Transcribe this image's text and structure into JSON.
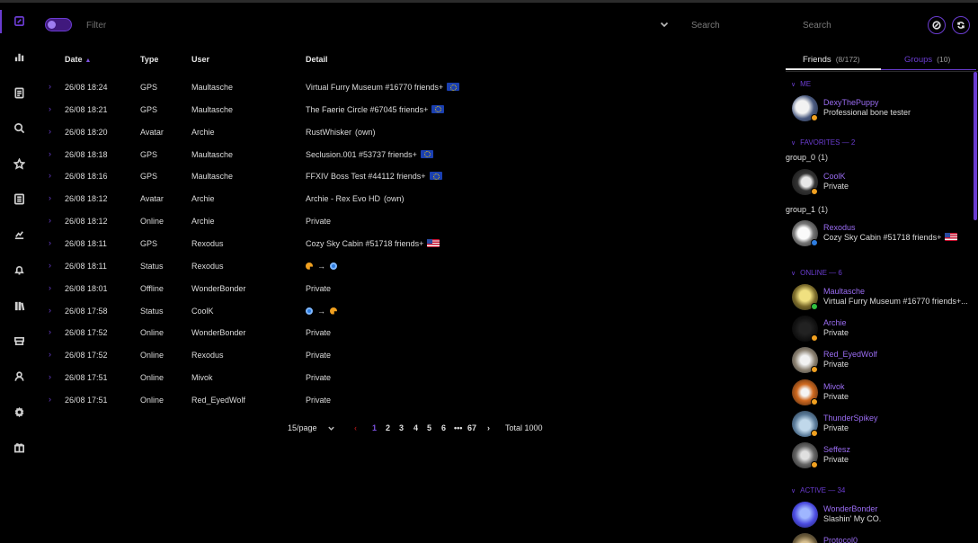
{
  "toolbar": {
    "filter_placeholder": "Filter",
    "search1_placeholder": "Search",
    "search2_placeholder": "Search"
  },
  "sidebar_icons": [
    "feed-icon",
    "chart-icon",
    "document-icon",
    "search-icon",
    "star-icon",
    "list-icon",
    "moderation-icon",
    "bell-icon",
    "book-icon",
    "shop-icon",
    "user-icon",
    "gear-icon",
    "gift-icon"
  ],
  "feed": {
    "columns": {
      "date": "Date",
      "type": "Type",
      "user": "User",
      "detail": "Detail"
    },
    "rows": [
      {
        "date": "26/08 18:24",
        "type": "GPS",
        "user": "Maultasche",
        "detail": "Virtual Furry Museum #16770 friends+",
        "flag": "eu"
      },
      {
        "date": "26/08 18:21",
        "type": "GPS",
        "user": "Maultasche",
        "detail": "The Faerie Circle #67045 friends+",
        "flag": "eu"
      },
      {
        "date": "26/08 18:20",
        "type": "Avatar",
        "user": "Archie",
        "detail": "RustWhisker",
        "own": "(own)"
      },
      {
        "date": "26/08 18:18",
        "type": "GPS",
        "user": "Maultasche",
        "detail": "Seclusion.001 #53737 friends+",
        "flag": "eu"
      },
      {
        "date": "26/08 18:16",
        "type": "GPS",
        "user": "Maultasche",
        "detail": "FFXIV Boss Test #44112 friends+",
        "flag": "eu"
      },
      {
        "date": "26/08 18:12",
        "type": "Avatar",
        "user": "Archie",
        "detail": "Archie - Rex Evo HD",
        "own": "(own)"
      },
      {
        "date": "26/08 18:12",
        "type": "Online",
        "user": "Archie",
        "detail": "Private"
      },
      {
        "date": "26/08 18:11",
        "type": "GPS",
        "user": "Rexodus",
        "detail": "Cozy Sky Cabin #51718 friends+",
        "flag": "us"
      },
      {
        "date": "26/08 18:11",
        "type": "Status",
        "user": "Rexodus",
        "detail": "",
        "status_change": [
          "orange",
          "blue"
        ]
      },
      {
        "date": "26/08 18:01",
        "type": "Offline",
        "user": "WonderBonder",
        "detail": "Private"
      },
      {
        "date": "26/08 17:58",
        "type": "Status",
        "user": "CoolK",
        "detail": "",
        "status_change": [
          "blue",
          "orange"
        ]
      },
      {
        "date": "26/08 17:52",
        "type": "Online",
        "user": "WonderBonder",
        "detail": "Private"
      },
      {
        "date": "26/08 17:52",
        "type": "Online",
        "user": "Rexodus",
        "detail": "Private"
      },
      {
        "date": "26/08 17:51",
        "type": "Online",
        "user": "Mivok",
        "detail": "Private"
      },
      {
        "date": "26/08 17:51",
        "type": "Online",
        "user": "Red_EyedWolf",
        "detail": "Private"
      }
    ]
  },
  "pagination": {
    "page_size": "15/page",
    "pages": [
      "1",
      "2",
      "3",
      "4",
      "5",
      "6",
      "•••",
      "67"
    ],
    "current": "1",
    "total": "Total 1000"
  },
  "friends_panel": {
    "tab_friends": "Friends",
    "tab_friends_count": "(8/172)",
    "tab_groups": "Groups",
    "tab_groups_count": "(10)",
    "section_me": "ME",
    "section_favorites": "FAVORITES — 2",
    "section_online": "ONLINE — 6",
    "section_active": "ACTIVE — 34",
    "group0_name": "group_0",
    "group0_count": "(1)",
    "group1_name": "group_1",
    "group1_count": "(1)",
    "me": {
      "name": "DexyThePuppy",
      "status": "Professional bone tester"
    },
    "favorites": [
      {
        "name": "CoolK",
        "status": "Private"
      },
      {
        "name": "Rexodus",
        "status": "Cozy Sky Cabin #51718 friends+"
      }
    ],
    "online": [
      {
        "name": "Maultasche",
        "status": "Virtual Furry Museum #16770 friends+..."
      },
      {
        "name": "Archie",
        "status": "Private"
      },
      {
        "name": "Red_EyedWolf",
        "status": "Private"
      },
      {
        "name": "Mivok",
        "status": "Private"
      },
      {
        "name": "ThunderSpikey",
        "status": "Private"
      },
      {
        "name": "Seffesz",
        "status": "Private"
      }
    ],
    "active": [
      {
        "name": "WonderBonder",
        "status": "Slashin' My CO."
      },
      {
        "name": "Protocol0",
        "status": ""
      }
    ]
  },
  "colors": {
    "accent": "#6a3cd0",
    "own": "#e58a12",
    "status_orange": "#f0a020",
    "status_blue": "#2e7de0"
  }
}
